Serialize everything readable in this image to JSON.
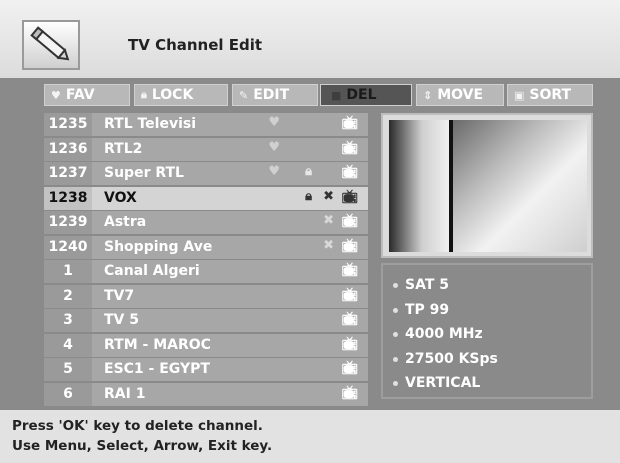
{
  "window": {
    "title": "TV Channel Edit",
    "icon": "pencil-icon"
  },
  "toolbar": {
    "buttons": [
      {
        "label": "FAV",
        "icon": "heart-icon"
      },
      {
        "label": "LOCK",
        "icon": "lock-icon"
      },
      {
        "label": "EDIT",
        "icon": "edit-icon"
      },
      {
        "label": "DEL",
        "icon": "delete-icon",
        "active": true
      },
      {
        "label": "MOVE",
        "icon": "move-icon"
      },
      {
        "label": "SORT",
        "icon": "sort-icon"
      }
    ]
  },
  "channels": [
    {
      "num": "1235",
      "name": "RTL Televisi",
      "fav": true,
      "lock": false,
      "skip": false
    },
    {
      "num": "1236",
      "name": "RTL2",
      "fav": true,
      "lock": false,
      "skip": false
    },
    {
      "num": "1237",
      "name": "Super RTL",
      "fav": true,
      "lock": true,
      "skip": false
    },
    {
      "num": "1238",
      "name": "VOX",
      "fav": false,
      "lock": true,
      "skip": true,
      "selected": true
    },
    {
      "num": "1239",
      "name": "Astra",
      "fav": false,
      "lock": false,
      "skip": true
    },
    {
      "num": "1240",
      "name": "Shopping Ave",
      "fav": false,
      "lock": false,
      "skip": true
    },
    {
      "num": "1",
      "name": "Canal Algeri",
      "fav": false,
      "lock": false,
      "skip": false
    },
    {
      "num": "2",
      "name": "TV7",
      "fav": false,
      "lock": false,
      "skip": false
    },
    {
      "num": "3",
      "name": "TV 5",
      "fav": false,
      "lock": false,
      "skip": false
    },
    {
      "num": "4",
      "name": "RTM - MAROC",
      "fav": false,
      "lock": false,
      "skip": false
    },
    {
      "num": "5",
      "name": "ESC1 - EGYPT",
      "fav": false,
      "lock": false,
      "skip": false
    },
    {
      "num": "6",
      "name": "RAI 1",
      "fav": false,
      "lock": false,
      "skip": false
    }
  ],
  "info": {
    "items": [
      "SAT 5",
      "TP 99",
      "4000 MHz",
      "27500 KSps",
      "VERTICAL"
    ]
  },
  "help": {
    "line1": "Press 'OK' key to delete channel.",
    "line2": "Use Menu, Select, Arrow, Exit key."
  }
}
